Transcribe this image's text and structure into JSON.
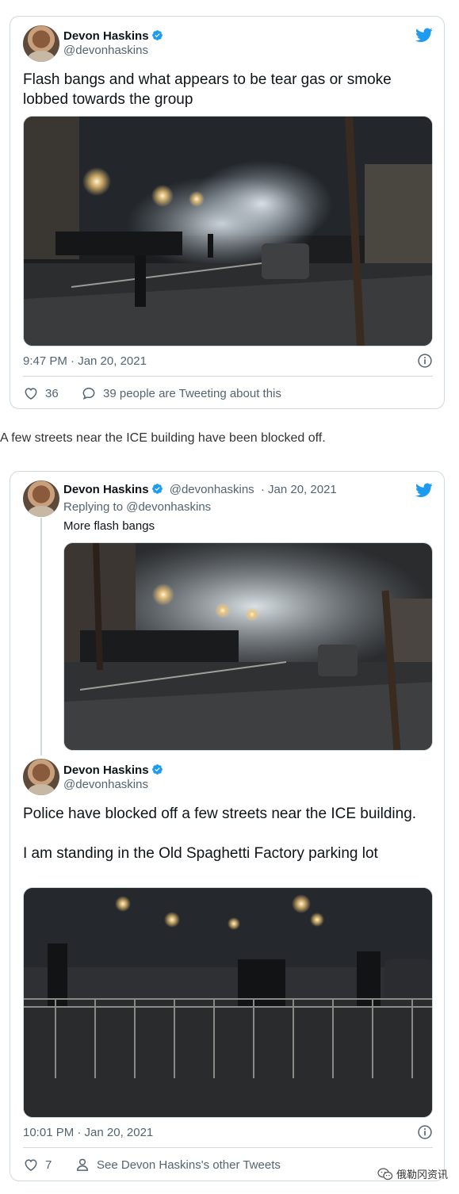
{
  "tweet1": {
    "author_name": "Devon Haskins",
    "author_handle": "@devonhaskins",
    "text": "Flash bangs and what appears to be tear gas or smoke lobbed towards the group",
    "timestamp": "9:47 PM · Jan 20, 2021",
    "likes": "36",
    "conversation": "39 people are Tweeting about this"
  },
  "between_text": "A few streets near the ICE building have been blocked off.",
  "tweet2": {
    "reply": {
      "author_name": "Devon Haskins",
      "author_handle": "@devonhaskins",
      "date": "· Jan 20, 2021",
      "replying_to": "Replying to @devonhaskins",
      "text": "More flash bangs"
    },
    "main": {
      "author_name": "Devon Haskins",
      "author_handle": "@devonhaskins",
      "text": "Police have blocked off a few streets near the ICE building.\n\nI am standing in the Old Spaghetti Factory parking lot",
      "timestamp": "10:01 PM · Jan 20, 2021",
      "likes": "7",
      "profile_link": "See Devon Haskins's other Tweets"
    }
  },
  "watermark": "俄勒冈资讯",
  "colors": {
    "twitter_blue": "#1d9bf0",
    "secondary_text": "#536471",
    "border": "#cfd9de"
  },
  "icons": [
    "twitter-bird-icon",
    "verified-badge-icon",
    "info-icon",
    "heart-icon",
    "speech-bubble-icon",
    "person-icon",
    "wechat-icon"
  ]
}
